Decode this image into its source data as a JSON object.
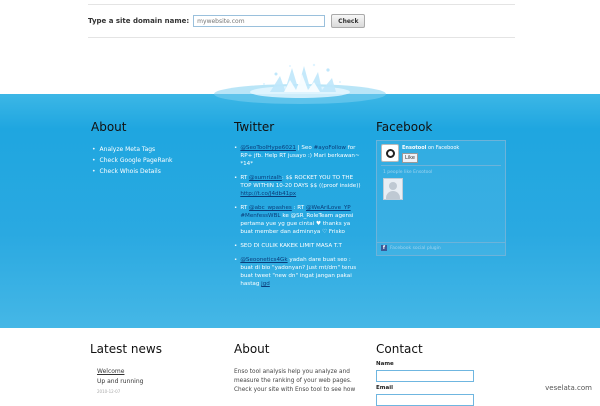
{
  "search": {
    "label": "Type a site domain name:",
    "placeholder": "mywebsite.com",
    "button": "Check"
  },
  "about": {
    "title": "About",
    "links": [
      "Analyze Meta Tags",
      "Check Google PageRank",
      "Check Whois Details"
    ]
  },
  "twitter": {
    "title": "Twitter",
    "tweets": [
      {
        "link": "@SeoToolHype6021",
        "mid": " | Seo ",
        "tag": "#ayoFollow",
        "text": " for RP+ jfb. Help RT jusayo :) Mari berkawan~ *14*"
      },
      {
        "prefix": "RT ",
        "link": "@sumrizalh",
        "text": ": $$ ROCKET YOU TO THE TOP WITHIN 10-20 DAYS $$ ((proof inside)) ",
        "link2": "http://t.co/J4db41px"
      },
      {
        "prefix": "RT ",
        "link": "@abc_wpashes",
        "mid": " : RT ",
        "tag": "@WeAriLove_YP",
        "tag2": " #MenfessWBL",
        "text": " ke @SR_RoleTeam agensi pertama yue yg gue cintai ♥ thanks ya buat member dan adminnya ♡ Frisko"
      },
      {
        "text": "SEO DI CULIK KAKEK LIMIT MASA T.T"
      },
      {
        "link": "@Seoonetics4Gk",
        "text": " yadah dare buat seo : buat di bio \"yadonyan? Just mt/dm\" terus buat tweet \"new dn\" ingat jangan pakai hastag ",
        "link2": "jgd"
      }
    ]
  },
  "facebook": {
    "title": "Facebook",
    "page_name": "Ensotool",
    "on_text": " on Facebook",
    "like_label": "Like",
    "people_label": "1 people like Ensotool",
    "footer": "Facebook social plugin"
  },
  "news": {
    "title": "Latest news",
    "item_title": "Welcome",
    "item_text": "Up and running",
    "item_date": "2010-12-07"
  },
  "about2": {
    "title": "About",
    "text": "Enso tool analysis help you analyze and measure the ranking of your web pages. Check your site with Enso tool to see how"
  },
  "contact": {
    "title": "Contact",
    "name_label": "Name",
    "email_label": "Email"
  },
  "watermark": "veselata.com"
}
